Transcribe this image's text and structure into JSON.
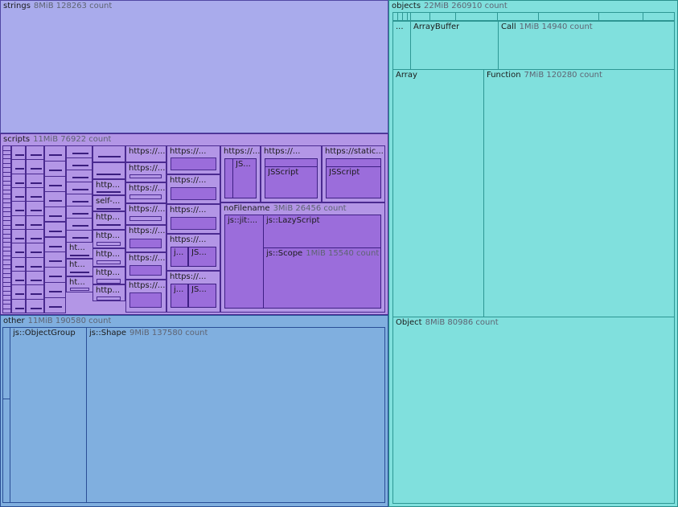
{
  "strings": {
    "name": "strings",
    "size": "8MiB",
    "count": "128263 count"
  },
  "scripts": {
    "name": "scripts",
    "size": "11MiB",
    "count": "76922 count",
    "cells": {
      "c1": "https://...",
      "c2": "https://...",
      "c3": "https://...",
      "c4": "https://...",
      "c5": "http...",
      "c6": "self-...",
      "c7": "http...",
      "c8": "http...",
      "c9": "http...",
      "c10": "http...",
      "c11": "ht...",
      "c12": "ht...",
      "c13": "ht...",
      "c14": "https://...",
      "c15": "https://...",
      "c16": "https://...",
      "c17": "https://...",
      "c18": "https://...",
      "c19": "https://...",
      "c20": "https://...",
      "c21": "https://...",
      "c22": "https://...",
      "c23": "https://...",
      "c24": "https://...",
      "c25": "https://static...",
      "jsA": "JS...",
      "jsB": "j...",
      "jsC": "JS...",
      "jsD": "j...",
      "jsE": "JS...",
      "jsscript1": "JSScript",
      "jsscript2": "JSScript"
    },
    "noFilename": {
      "name": "noFilename",
      "size": "3MiB",
      "count": "26456 count",
      "jit": "js::jit:...",
      "lazy": "js::LazyScript",
      "scope": {
        "name": "js::Scope",
        "size": "1MiB",
        "count": "15540 count"
      }
    }
  },
  "other": {
    "name": "other",
    "size": "11MiB",
    "count": "190580 count",
    "objectGroup": "js::ObjectGroup",
    "shape": {
      "name": "js::Shape",
      "size": "9MiB",
      "count": "137580 count"
    }
  },
  "objects": {
    "name": "objects",
    "size": "22MiB",
    "count": "260910 count",
    "ellipsis": "...",
    "arrayBuffer": "ArrayBuffer",
    "call": {
      "name": "Call",
      "size": "1MiB",
      "count": "14940 count"
    },
    "array": "Array",
    "function": {
      "name": "Function",
      "size": "7MiB",
      "count": "120280 count"
    },
    "object": {
      "name": "Object",
      "size": "8MiB",
      "count": "80986 count"
    }
  },
  "colors": {
    "strings": "#a9abec",
    "scripts": "#b396e6",
    "other": "#80afdf",
    "objects": "#80e0dd"
  }
}
